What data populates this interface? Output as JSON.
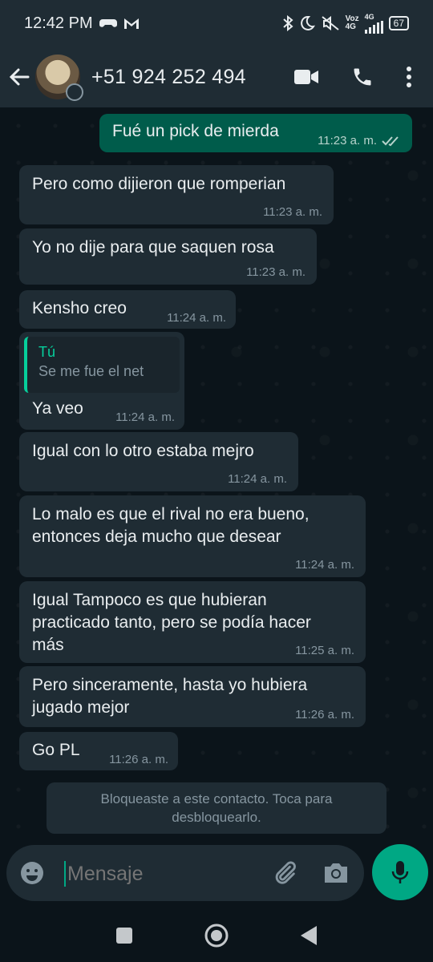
{
  "status_bar": {
    "time": "12:42 PM",
    "network_label_top": "Voz",
    "network_label_bottom": "4G",
    "network_label_2": "4G",
    "battery": "67"
  },
  "header": {
    "contact_name": "+51 924 252 494",
    "back_icon": "arrow-left-icon",
    "video_icon": "video-camera-icon",
    "call_icon": "phone-icon",
    "menu_icon": "more-vertical-icon"
  },
  "messages": [
    {
      "direction": "out",
      "text": "Fué un pick de mierda",
      "time": "11:23 a. m.",
      "read": true
    },
    {
      "direction": "in",
      "text": "Pero como dijieron que romperian",
      "time": "11:23 a. m."
    },
    {
      "direction": "in",
      "text": "Yo no dije para que saquen rosa",
      "time": "11:23 a. m."
    },
    {
      "direction": "in",
      "text": "Kensho creo",
      "time": "11:24 a. m."
    },
    {
      "direction": "in",
      "quote_author": "Tú",
      "quote_text": "Se me fue el net",
      "text": "Ya veo",
      "time": "11:24 a. m."
    },
    {
      "direction": "in",
      "text": "Igual con lo otro estaba mejro",
      "time": "11:24 a. m."
    },
    {
      "direction": "in",
      "text_lines": [
        "Lo malo es que el rival no era bueno,",
        "entonces deja mucho que desear"
      ],
      "time": "11:24 a. m."
    },
    {
      "direction": "in",
      "text_lines": [
        "Igual Tampoco es que hubieran",
        "practicado tanto, pero se podía hacer",
        "más"
      ],
      "time": "11:25 a. m."
    },
    {
      "direction": "in",
      "text_lines": [
        "Pero sinceramente, hasta yo hubiera",
        "jugado mejor"
      ],
      "time": "11:26 a. m."
    },
    {
      "direction": "in",
      "text": "Go PL",
      "time": "11:26 a. m."
    }
  ],
  "blocked_notice": {
    "line1": "Bloqueaste a este contacto. Toca para",
    "line2": "desbloquearlo."
  },
  "input": {
    "placeholder": "Mensaje"
  },
  "colors": {
    "accent": "#00a884",
    "outgoing_bubble": "#005c4b",
    "incoming_bubble": "#1f2c34",
    "background": "#0b141a"
  }
}
